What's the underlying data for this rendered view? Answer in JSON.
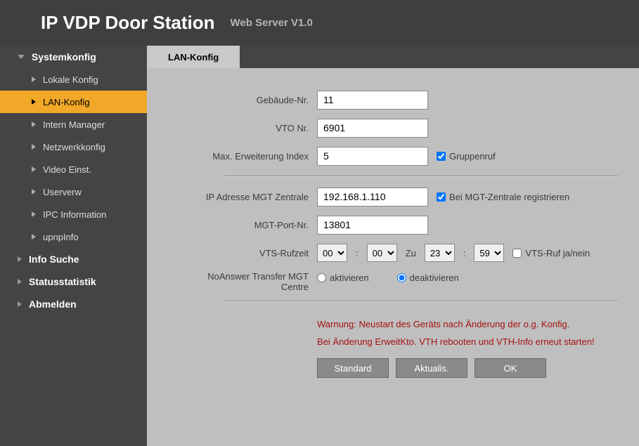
{
  "header": {
    "title": "IP VDP Door Station",
    "subtitle": "Web Server V1.0"
  },
  "sidebar": {
    "groups": [
      {
        "label": "Systemkonfig",
        "expanded": true
      },
      {
        "label": "Info Suche",
        "expanded": false
      },
      {
        "label": "Statusstatistik",
        "expanded": false
      },
      {
        "label": "Abmelden",
        "expanded": false
      }
    ],
    "systemItems": [
      {
        "label": "Lokale Konfig",
        "active": false
      },
      {
        "label": "LAN-Konfig",
        "active": true
      },
      {
        "label": "Intern Manager",
        "active": false
      },
      {
        "label": "Netzwerkkonfig",
        "active": false
      },
      {
        "label": "Video Einst.",
        "active": false
      },
      {
        "label": "Userverw",
        "active": false
      },
      {
        "label": "IPC Information",
        "active": false
      },
      {
        "label": "upnpInfo",
        "active": false
      }
    ]
  },
  "tabs": {
    "active": "LAN-Konfig"
  },
  "form": {
    "building_no_label": "Gebäude-Nr.",
    "building_no": "11",
    "vto_no_label": "VTO Nr.",
    "vto_no": "6901",
    "max_ext_label": "Max. Erweiterung Index",
    "max_ext": "5",
    "group_call_label": "Gruppenruf",
    "group_call_checked": true,
    "mgt_ip_label": "IP Adresse MGT Zentrale",
    "mgt_ip": "192.168.1.110",
    "mgt_register_label": "Bei MGT-Zentrale registrieren",
    "mgt_register_checked": true,
    "mgt_port_label": "MGT-Port-Nr.",
    "mgt_port": "13801",
    "vts_time_label": "VTS-Rufzeit",
    "vts_from_h": "00",
    "vts_from_m": "00",
    "to_label": "Zu",
    "vts_to_h": "23",
    "vts_to_m": "59",
    "vts_call_label": "VTS-Ruf ja/nein",
    "vts_call_checked": false,
    "noanswer_label_l1": "NoAnswer Transfer MGT",
    "noanswer_label_l2": "Centre",
    "activate_label": "aktivieren",
    "deactivate_label": "deaktivieren",
    "noanswer_value": "deactivate"
  },
  "warnings": {
    "line1": "Warnung: Neustart des Geräts nach Änderung der o.g. Konfig.",
    "line2": "Bei Änderung ErweitKto. VTH rebooten und VTH-Info erneut starten!"
  },
  "buttons": {
    "default": "Standard",
    "refresh": "Aktualis.",
    "ok": "OK"
  }
}
